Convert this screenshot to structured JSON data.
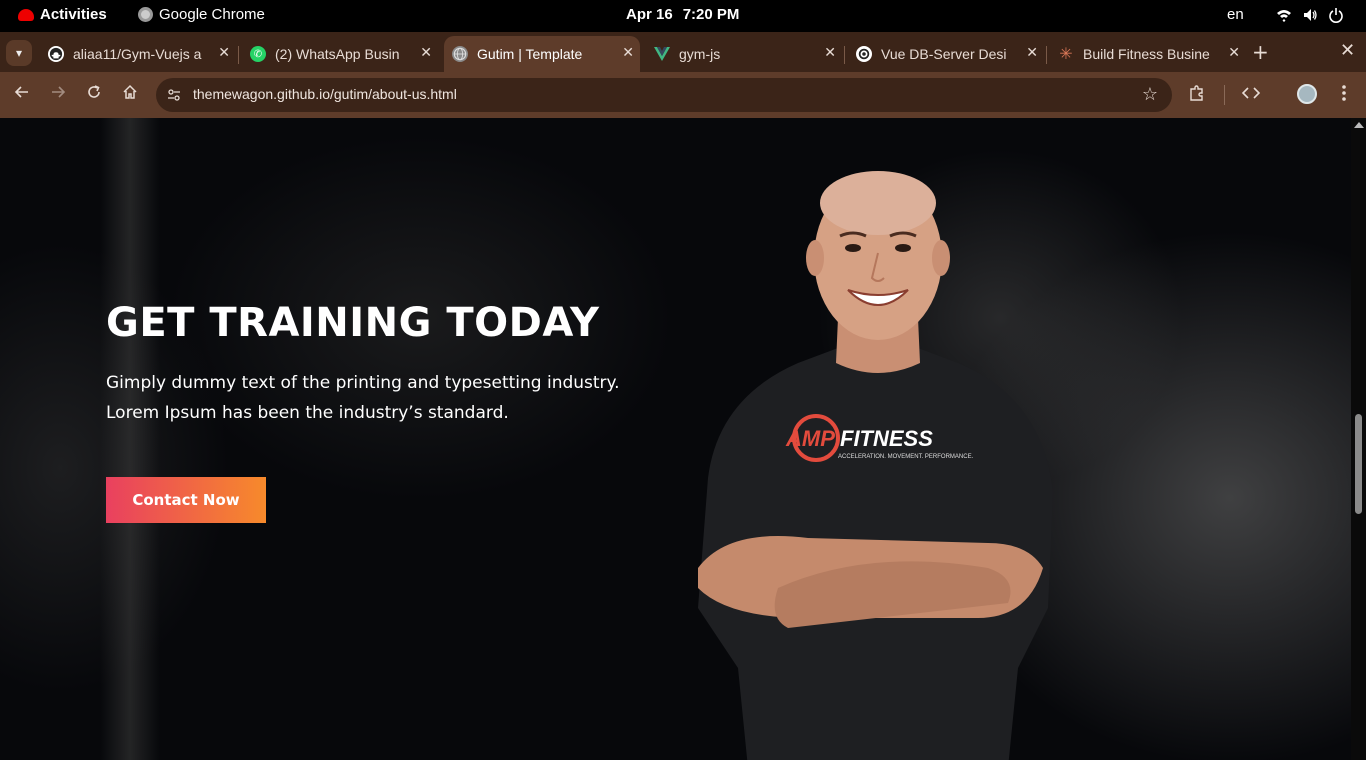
{
  "system_bar": {
    "activities": "Activities",
    "app_name": "Google Chrome",
    "date": "Apr 16",
    "time": "7:20 PM",
    "language": "en",
    "icons": [
      "wifi-icon",
      "volume-icon",
      "power-icon"
    ]
  },
  "tabs": [
    {
      "label": "aliaa11/Gym-Vuejs a",
      "icon": "github-icon",
      "active": false
    },
    {
      "label": "(2) WhatsApp Busin",
      "icon": "whatsapp-icon",
      "active": false
    },
    {
      "label": "Gutim | Template",
      "icon": "globe-icon",
      "active": true
    },
    {
      "label": "gym-js",
      "icon": "vue-icon",
      "active": false
    },
    {
      "label": "Vue DB-Server Desi",
      "icon": "openai-icon",
      "active": false
    },
    {
      "label": "Build Fitness Busine",
      "icon": "claude-icon",
      "active": false
    }
  ],
  "toolbar": {
    "url": "themewagon.github.io/gutim/about-us.html"
  },
  "hero": {
    "title": "GET TRAINING TODAY",
    "text_line1": "Gimply dummy text of the printing and typesetting industry.",
    "text_line2": "Lorem Ipsum has been the industry’s standard.",
    "cta_label": "Contact Now",
    "shirt_brand": "AMP FITNESS",
    "shirt_tagline": "ACCELERATION. MOVEMENT. PERFORMANCE."
  },
  "colors": {
    "cta_start": "#e9405f",
    "cta_end": "#f78a2b",
    "chrome_frame": "#3b2418",
    "chrome_toolbar": "#5e3c2a"
  }
}
